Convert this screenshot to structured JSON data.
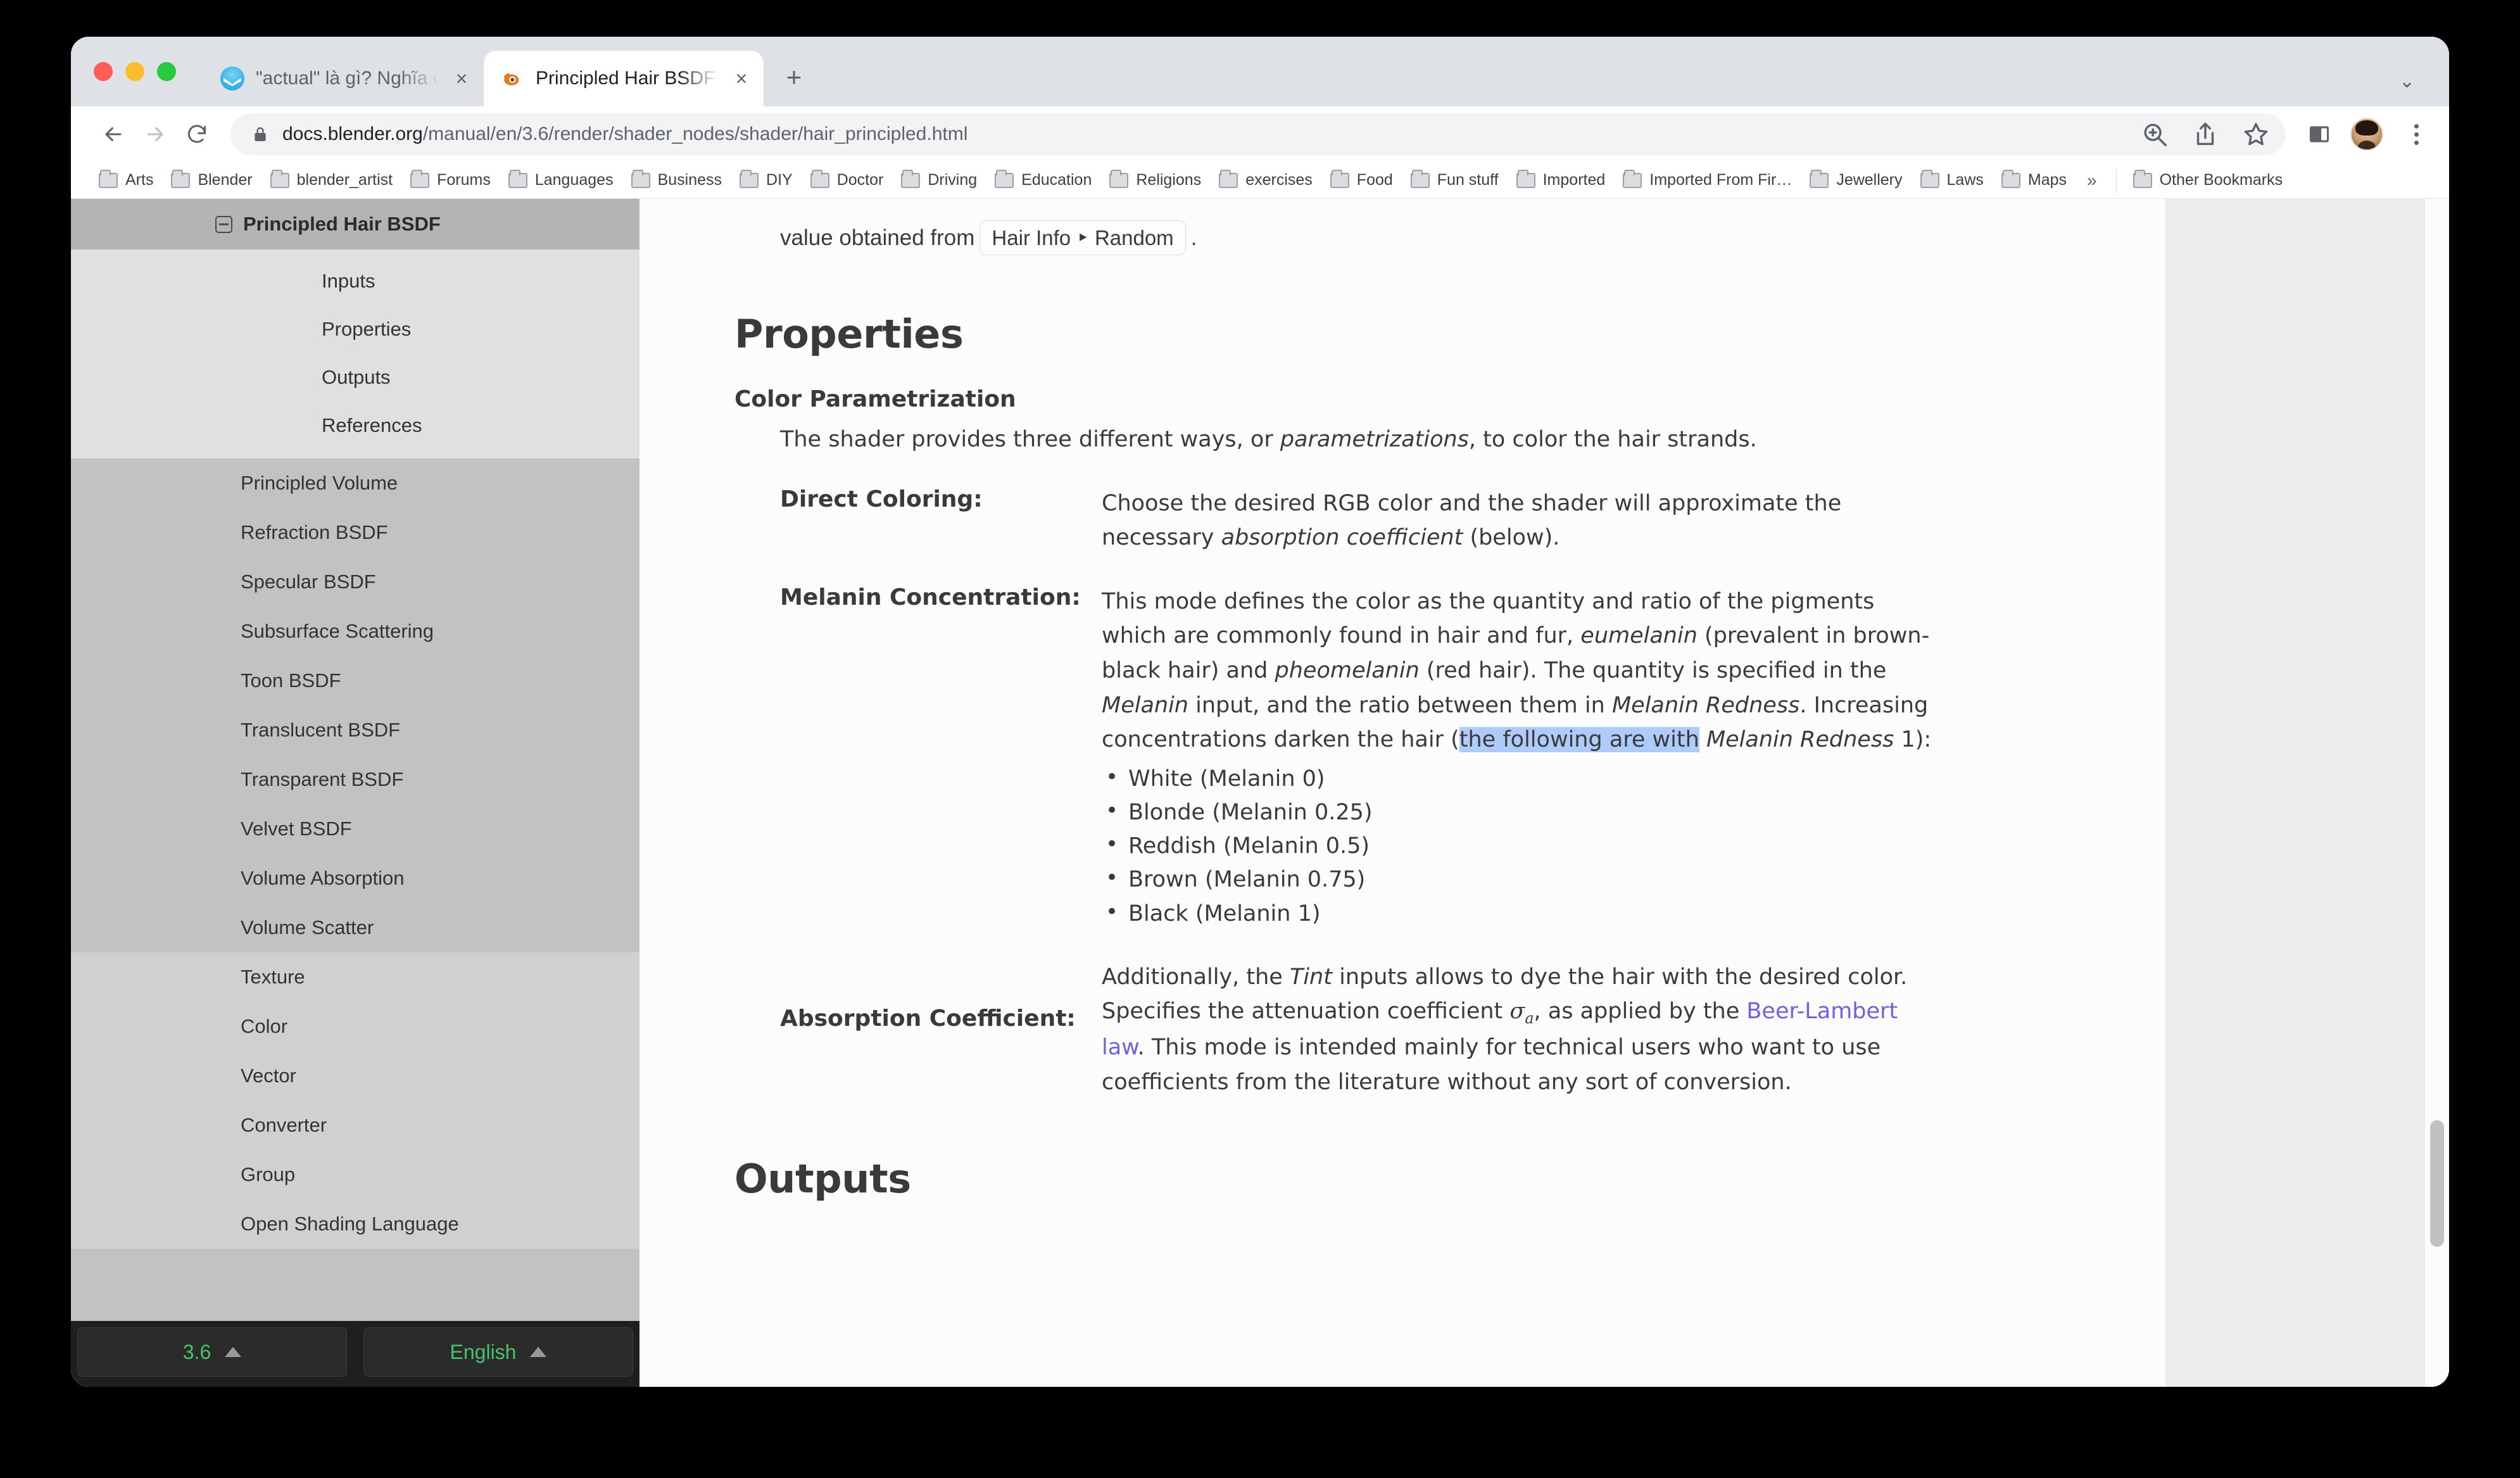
{
  "window": {
    "tabs": [
      {
        "title": "\"actual\" là gì? Nghĩa của từ actual",
        "favicon": "studyvn-icon",
        "close_label": "×",
        "active": false
      },
      {
        "title": "Principled Hair BSDF — Blender",
        "favicon": "blender-icon",
        "close_label": "×",
        "active": true
      }
    ],
    "new_tab_label": "+",
    "window_menu_label": "⌄"
  },
  "toolbar": {
    "back_label": "back-arrow",
    "forward_label": "forward-arrow",
    "reload_label": "reload",
    "url_host": "docs.blender.org",
    "url_path": "/manual/en/3.6/render/shader_nodes/shader/hair_principled.html",
    "url_full": "docs.blender.org/manual/en/3.6/render/shader_nodes/shader/hair_principled.html",
    "zoom_icon": "zoom-in-icon",
    "share_icon": "share-icon",
    "bookmark_icon": "star-icon",
    "side_panel_icon": "side-panel-icon",
    "profile_icon": "avatar",
    "menu_icon": "three-dots-icon"
  },
  "bookmarks": {
    "items": [
      "Arts",
      "Blender",
      "blender_artist",
      "Forums",
      "Languages",
      "Business",
      "DIY",
      "Doctor",
      "Driving",
      "Education",
      "Religions",
      "exercises",
      "Food",
      "Fun stuff",
      "Imported",
      "Imported From Fir…",
      "Jewellery",
      "Laws",
      "Maps"
    ],
    "overflow_label": "»",
    "other_bookmarks_label": "Other Bookmarks"
  },
  "sidebar": {
    "current_section": "Principled Hair BSDF",
    "current_children": [
      "Inputs",
      "Properties",
      "Outputs",
      "References"
    ],
    "siblings": [
      "Principled Volume",
      "Refraction BSDF",
      "Specular BSDF",
      "Subsurface Scattering",
      "Toon BSDF",
      "Translucent BSDF",
      "Transparent BSDF",
      "Velvet BSDF",
      "Volume Absorption",
      "Volume Scatter"
    ],
    "categories": [
      "Texture",
      "Color",
      "Vector",
      "Converter",
      "Group",
      "Open Shading Language"
    ],
    "footer": {
      "version": "3.6",
      "language": "English"
    }
  },
  "content": {
    "top_fragment_prefix": "value obtained from",
    "top_fragment_ref": "Hair Info ‣ Random",
    "top_fragment_suffix": ".",
    "properties_heading": "Properties",
    "color_param": {
      "term": "Color Parametrization",
      "desc_pre": "The shader provides three different ways, or ",
      "desc_em": "parametrizations",
      "desc_post": ", to color the hair strands."
    },
    "direct_coloring": {
      "name": "Direct Coloring:",
      "line1": "Choose the desired RGB color and the shader will approximate the",
      "line2_pre": "necessary ",
      "line2_em": "absorption coefficient",
      "line2_post": " (below)."
    },
    "melanin": {
      "name": "Melanin Concentration:",
      "p1": "This mode defines the color as the quantity and ratio of the pigments",
      "p2_pre": "which are commonly found in hair and fur, ",
      "p2_em1": "eumelanin",
      "p2_mid": " (prevalent in brown-",
      "p3_pre": "black hair) and ",
      "p3_em": "pheomelanin",
      "p3_post": " (red hair). The quantity is specified in the",
      "p4_em1": "Melanin",
      "p4_mid": " input, and the ratio between them in ",
      "p4_em2": "Melanin Redness",
      "p4_post": ". Increasing",
      "p5_pre": "concentrations darken the hair (",
      "p5_selected": "the following are with",
      "p5_em": " Melanin Redness",
      "p5_post": " 1):",
      "list": [
        "White (Melanin 0)",
        "Blonde (Melanin 0.25)",
        "Reddish (Melanin 0.5)",
        "Brown (Melanin 0.75)",
        "Black (Melanin 1)"
      ],
      "tail_pre": "Additionally, the ",
      "tail_em": "Tint",
      "tail_post": " inputs allows to dye the hair with the desired color."
    },
    "absorption": {
      "name": "Absorption Coefficient:",
      "line1_pre": "Specifies the attenuation coefficient ",
      "sigma": "σ",
      "sigma_sub": "a",
      "line1_mid": ", as applied by the ",
      "link_part1": "Beer-Lambert",
      "link_part2": "law",
      "line2_post": ". This mode is intended mainly for technical users who want to use",
      "line3": "coefficients from the literature without any sort of conversion."
    },
    "outputs_heading": "Outputs"
  },
  "colors": {
    "selection_highlight": "#aecbfa",
    "link": "#6c63e0",
    "sidebar_bg": "#c2c2c2",
    "footer_accent": "#46c46c"
  }
}
